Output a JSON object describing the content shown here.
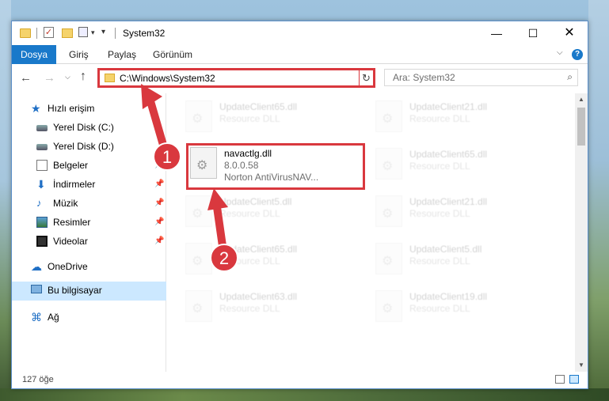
{
  "window": {
    "title": "System32",
    "minimize_glyph": "—",
    "maximize_glyph": "☐",
    "close_glyph": "✕"
  },
  "ribbon": {
    "tabs": [
      "Dosya",
      "Giriş",
      "Paylaş",
      "Görünüm"
    ],
    "help_glyph": "?",
    "expand_glyph": "⌵"
  },
  "navigation": {
    "back_glyph": "←",
    "forward_glyph": "→",
    "recent_glyph": "⌵",
    "up_glyph": "↑",
    "address": "C:\\Windows\\System32",
    "address_dropdown": "⌵",
    "refresh_glyph": "↻",
    "search_placeholder": "Ara: System32",
    "search_glyph": "⌕"
  },
  "sidebar": {
    "items": [
      {
        "label": "Hızlı erişim",
        "icon": "star-icon",
        "pinned": false
      },
      {
        "label": "Yerel Disk (C:)",
        "icon": "drive-icon",
        "pinned": false
      },
      {
        "label": "Yerel Disk (D:)",
        "icon": "drive-icon",
        "pinned": false
      },
      {
        "label": "Belgeler",
        "icon": "documents-icon",
        "pinned": true
      },
      {
        "label": "İndirmeler",
        "icon": "downloads-icon",
        "pinned": true
      },
      {
        "label": "Müzik",
        "icon": "music-icon",
        "pinned": true
      },
      {
        "label": "Resimler",
        "icon": "pictures-icon",
        "pinned": true
      },
      {
        "label": "Videolar",
        "icon": "videos-icon",
        "pinned": true
      },
      {
        "label": "OneDrive",
        "icon": "cloud-icon",
        "pinned": false
      },
      {
        "label": "Bu bilgisayar",
        "icon": "computer-icon",
        "pinned": false,
        "selected": true
      },
      {
        "label": "Ağ",
        "icon": "network-icon",
        "pinned": false
      }
    ],
    "pin_glyph": "📌"
  },
  "files": {
    "highlighted": {
      "name": "navactlg.dll",
      "version": "8.0.0.58",
      "company": "Norton AntiVirusNAV..."
    },
    "ghost_left": [
      {
        "name": "UpdateClient65.dll",
        "desc": "Resource DLL"
      },
      {
        "name": "UpdateClient5.dll",
        "desc": "Resource DLL"
      },
      {
        "name": "UpdateClient65.dll",
        "desc": "Resource DLL"
      },
      {
        "name": "UpdateClient63.dll",
        "desc": "Resource DLL"
      }
    ],
    "ghost_right": [
      {
        "name": "UpdateClient21.dll",
        "desc": "Resource DLL"
      },
      {
        "name": "UpdateClient65.dll",
        "desc": "Resource DLL"
      },
      {
        "name": "UpdateClient21.dll",
        "desc": "Resource DLL"
      },
      {
        "name": "UpdateClient5.dll",
        "desc": "Resource DLL"
      },
      {
        "name": "UpdateClient19.dll",
        "desc": "Resource DLL"
      }
    ]
  },
  "status": {
    "item_count": "127 öğe"
  },
  "annotations": {
    "step1": "1",
    "step2": "2",
    "color": "#d9383e"
  }
}
